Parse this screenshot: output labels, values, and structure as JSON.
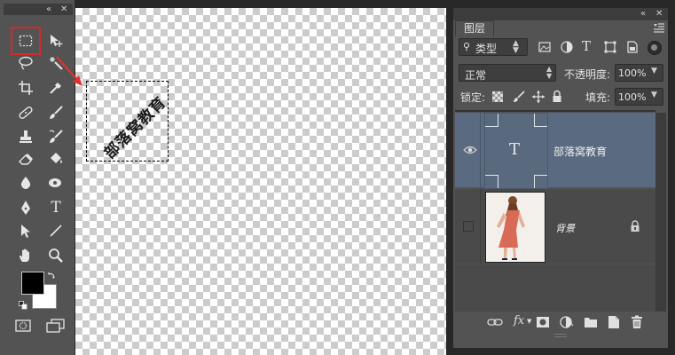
{
  "toolbox": {
    "collapse_icon": "double-chevron-left",
    "close_icon": "close",
    "tools": [
      {
        "name": "rectangular-marquee-tool",
        "icon": "marquee-rect"
      },
      {
        "name": "move-tool",
        "icon": "move"
      },
      {
        "name": "lasso-tool",
        "icon": "lasso"
      },
      {
        "name": "magic-wand-tool",
        "icon": "magic-wand"
      },
      {
        "name": "crop-tool",
        "icon": "crop"
      },
      {
        "name": "eyedropper-tool",
        "icon": "eyedropper"
      },
      {
        "name": "healing-brush-tool",
        "icon": "band-aid"
      },
      {
        "name": "brush-tool",
        "icon": "brush"
      },
      {
        "name": "clone-stamp-tool",
        "icon": "stamp"
      },
      {
        "name": "history-brush-tool",
        "icon": "history-brush"
      },
      {
        "name": "eraser-tool",
        "icon": "eraser"
      },
      {
        "name": "paint-bucket-tool",
        "icon": "bucket"
      },
      {
        "name": "blur-tool",
        "icon": "drop"
      },
      {
        "name": "dodge-tool",
        "icon": "dodge"
      },
      {
        "name": "pen-tool",
        "icon": "pen"
      },
      {
        "name": "type-tool",
        "icon": "type"
      },
      {
        "name": "path-selection-tool",
        "icon": "arrow"
      },
      {
        "name": "line-tool",
        "icon": "line"
      },
      {
        "name": "hand-tool",
        "icon": "hand"
      },
      {
        "name": "zoom-tool",
        "icon": "magnifier"
      }
    ],
    "type_tool_glyph": "T",
    "foreground_color": "#000000",
    "background_color": "#ffffff"
  },
  "canvas": {
    "selection_text": "部落窝教育",
    "annotation_arrow_color": "#e0322d"
  },
  "layers_panel": {
    "tab_label": "图层",
    "filter_kind_label": "类型",
    "blend_mode": "正常",
    "opacity_label": "不透明度:",
    "opacity_value": "100%",
    "lock_label": "锁定:",
    "fill_label": "填充:",
    "fill_value": "100%",
    "layers": [
      {
        "name": "部落窝教育",
        "type": "text",
        "thumb_glyph": "T",
        "visible": true,
        "selected": true
      },
      {
        "name": "背景",
        "type": "image",
        "visible": false,
        "locked": true
      }
    ],
    "footer_icons": [
      "link",
      "fx",
      "mask",
      "adjustment",
      "group",
      "new-layer",
      "trash"
    ],
    "fx_label": "fx"
  }
}
